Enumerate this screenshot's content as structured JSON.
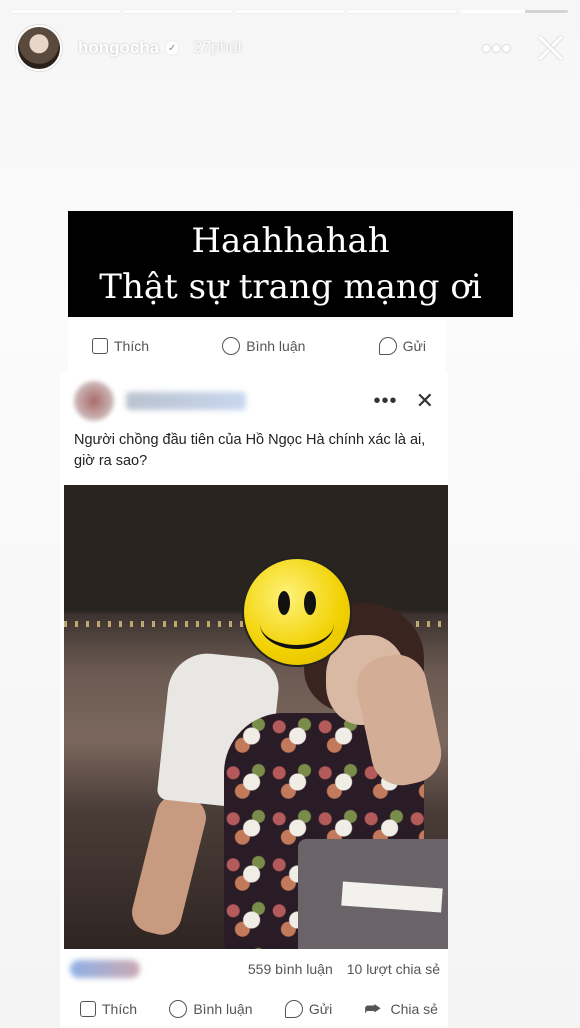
{
  "story": {
    "username": "hongocha",
    "time_ago": "27phút",
    "progress_segments": 5,
    "current_segment": 5,
    "caption_line1": "Haahhahah",
    "caption_line2": "Thật sự trang mạng ơi"
  },
  "fb_top_actions": {
    "like": "Thích",
    "comment": "Bình luận",
    "send": "Gửi"
  },
  "fb_post": {
    "text": "Người chồng đầu tiên của Hồ Ngọc Hà chính xác là ai, giờ ra sao?",
    "comments_count": "559 bình luận",
    "shares_count": "10 lượt chia sẻ",
    "actions": {
      "like": "Thích",
      "comment": "Bình luận",
      "send": "Gửi",
      "share": "Chia sẻ"
    }
  },
  "icons": [
    "verified-icon",
    "more-icon",
    "close-icon",
    "like-icon",
    "comment-icon",
    "messenger-icon",
    "share-icon",
    "smiley-sticker"
  ]
}
